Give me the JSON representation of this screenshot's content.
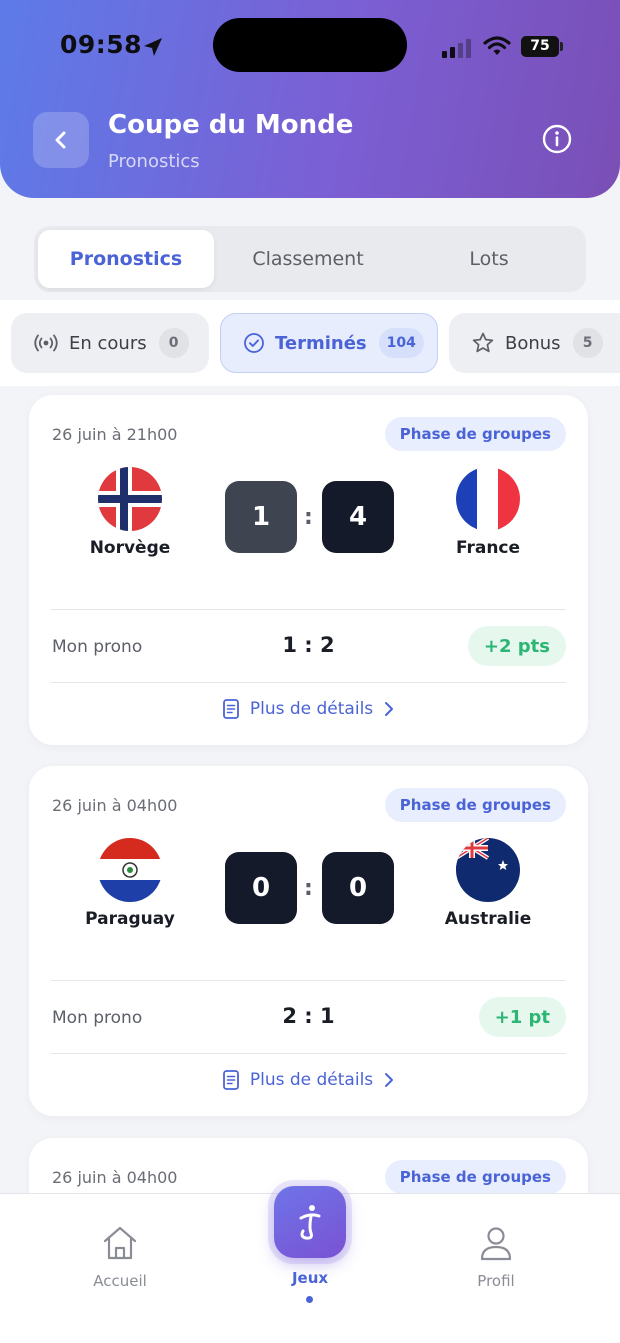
{
  "status_bar": {
    "time": "09:58",
    "battery": "75"
  },
  "header": {
    "title": "Coupe du Monde",
    "subtitle": "Pronostics"
  },
  "tabs": [
    {
      "label": "Pronostics",
      "active": true
    },
    {
      "label": "Classement",
      "active": false
    },
    {
      "label": "Lots",
      "active": false
    }
  ],
  "filters": [
    {
      "label": "En cours",
      "count": "0",
      "icon": "live-icon",
      "active": false
    },
    {
      "label": "Terminés",
      "count": "104",
      "icon": "check-circle-icon",
      "active": true
    },
    {
      "label": "Bonus",
      "count": "5",
      "icon": "star-icon",
      "active": false
    }
  ],
  "matches": [
    {
      "date": "26 juin à 21h00",
      "phase": "Phase de groupes",
      "home": {
        "name": "Norvège",
        "flag": "norway-flag",
        "score": "1"
      },
      "away": {
        "name": "France",
        "flag": "france-flag",
        "score": "4"
      },
      "prono_label": "Mon prono",
      "prono": "1 : 2",
      "points": "+2 pts",
      "details": "Plus de détails"
    },
    {
      "date": "26 juin à 04h00",
      "phase": "Phase de groupes",
      "home": {
        "name": "Paraguay",
        "flag": "paraguay-flag",
        "score": "0"
      },
      "away": {
        "name": "Australie",
        "flag": "australia-flag",
        "score": "0"
      },
      "prono_label": "Mon prono",
      "prono": "2 : 1",
      "points": "+1 pt",
      "details": "Plus de détails"
    },
    {
      "date": "26 juin à 04h00",
      "phase": "Phase de groupes"
    }
  ],
  "bottom_nav": [
    {
      "label": "Accueil",
      "icon": "home-icon"
    },
    {
      "label": "Jeux",
      "icon": "games-icon",
      "active": true
    },
    {
      "label": "Profil",
      "icon": "profile-icon"
    }
  ],
  "colors": {
    "accent": "#4a63d6",
    "success": "#2bb673",
    "header_start": "#5d7be8",
    "header_end": "#7a4fb6"
  }
}
